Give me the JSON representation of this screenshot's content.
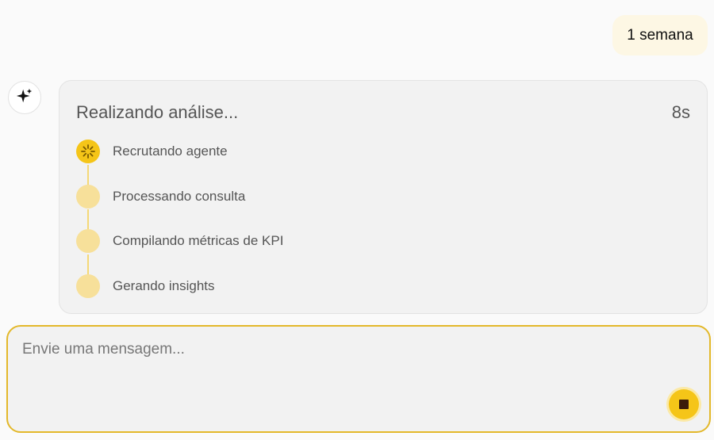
{
  "user_message": "1 semana",
  "assistant": {
    "avatar_icon": "sparkle-icon",
    "analysis": {
      "title": "Realizando análise...",
      "elapsed": "8s",
      "steps": [
        {
          "label": "Recrutando agente",
          "status": "active"
        },
        {
          "label": "Processando consulta",
          "status": "pending"
        },
        {
          "label": "Compilando métricas de KPI",
          "status": "pending"
        },
        {
          "label": "Gerando insights",
          "status": "pending"
        }
      ]
    }
  },
  "composer": {
    "placeholder": "Envie uma mensagem...",
    "value": "",
    "stop_icon": "stop-icon"
  },
  "colors": {
    "accent": "#f5c518",
    "accent_light": "#f7e09a",
    "composer_border": "#e3b82a",
    "user_bubble": "#fdf7e4"
  }
}
